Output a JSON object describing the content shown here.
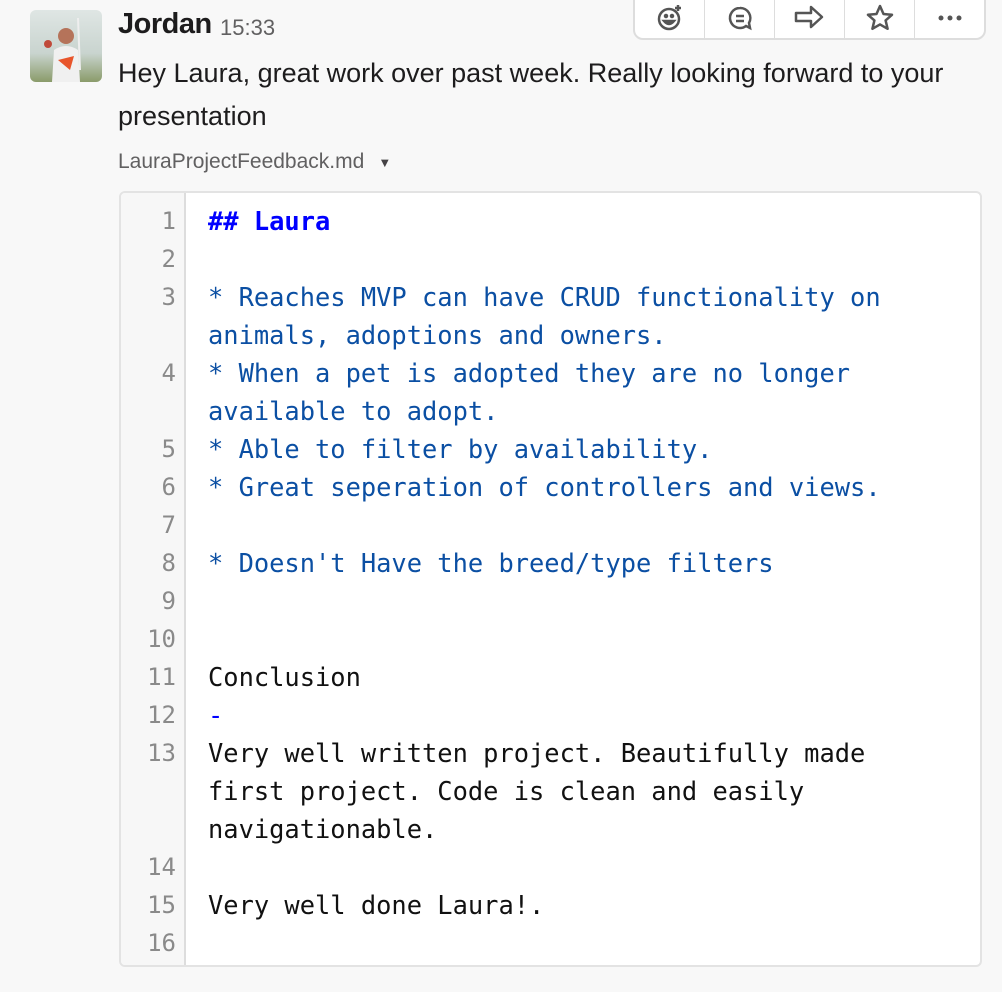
{
  "message": {
    "author": "Jordan",
    "time": "15:33",
    "text": "Hey Laura, great work over past week. Really looking forward to your presentation",
    "file_name": "LauraProjectFeedback.md"
  },
  "toolbar": [
    "add-reaction-icon",
    "reply-thread-icon",
    "share-icon",
    "star-icon",
    "more-icon"
  ],
  "code_lines": [
    {
      "n": "1",
      "t": "## Laura",
      "k": "h"
    },
    {
      "n": "2",
      "t": "",
      "k": "p"
    },
    {
      "n": "3",
      "t": "* Reaches MVP can have CRUD functionality on animals, adoptions and owners.",
      "k": "b"
    },
    {
      "n": "4",
      "t": "* When a pet is adopted they are no longer available to adopt.",
      "k": "b"
    },
    {
      "n": "5",
      "t": "* Able to filter by availability.",
      "k": "b"
    },
    {
      "n": "6",
      "t": "* Great seperation of controllers and views.",
      "k": "b"
    },
    {
      "n": "7",
      "t": "",
      "k": "p"
    },
    {
      "n": "8",
      "t": "* Doesn't Have the breed/type filters",
      "k": "b"
    },
    {
      "n": "9",
      "t": "",
      "k": "p"
    },
    {
      "n": "10",
      "t": "",
      "k": "p"
    },
    {
      "n": "11",
      "t": "Conclusion",
      "k": "p"
    },
    {
      "n": "12",
      "t": "-",
      "k": "d"
    },
    {
      "n": "13",
      "t": "Very well written project. Beautifully made first project. Code is clean and easily navigationable.",
      "k": "p"
    },
    {
      "n": "14",
      "t": "",
      "k": "p"
    },
    {
      "n": "15",
      "t": "Very well done Laura!.",
      "k": "p"
    },
    {
      "n": "16",
      "t": "",
      "k": "p"
    }
  ]
}
